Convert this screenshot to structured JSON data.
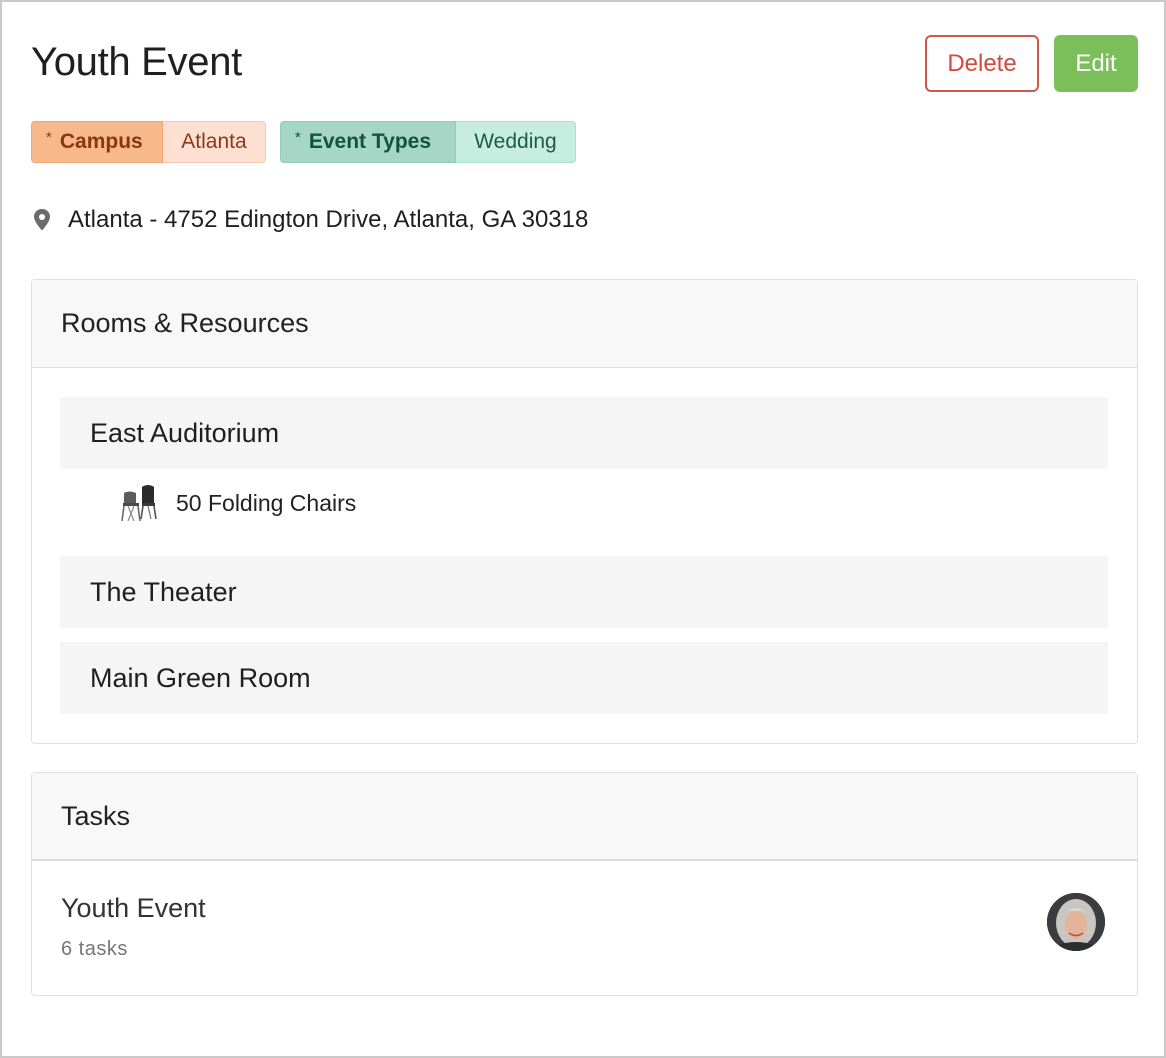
{
  "event": {
    "title": "Youth Event",
    "delete_label": "Delete",
    "edit_label": "Edit"
  },
  "tags": {
    "campus": {
      "star": "*",
      "key": "Campus",
      "value": "Atlanta"
    },
    "event_types": {
      "star": "*",
      "key": "Event Types",
      "value": "Wedding"
    }
  },
  "location": {
    "icon": "map-pin-icon",
    "text": "Atlanta - 4752 Edington Drive, Atlanta, GA 30318"
  },
  "rooms_card": {
    "header": "Rooms & Resources",
    "rooms": [
      {
        "name": "East Auditorium"
      },
      {
        "name": "The Theater"
      },
      {
        "name": "Main Green Room"
      }
    ],
    "resources": [
      {
        "icon": "folding-chairs-icon",
        "label": "50 Folding Chairs"
      }
    ]
  },
  "tasks_card": {
    "header": "Tasks",
    "items": [
      {
        "title": "Youth Event",
        "subtitle": "6 tasks"
      }
    ]
  },
  "colors": {
    "delete": "#d24a3f",
    "edit": "#7bbf5a",
    "campus_tag": "#f7b98c",
    "event_type_tag": "#a6d6c6"
  }
}
